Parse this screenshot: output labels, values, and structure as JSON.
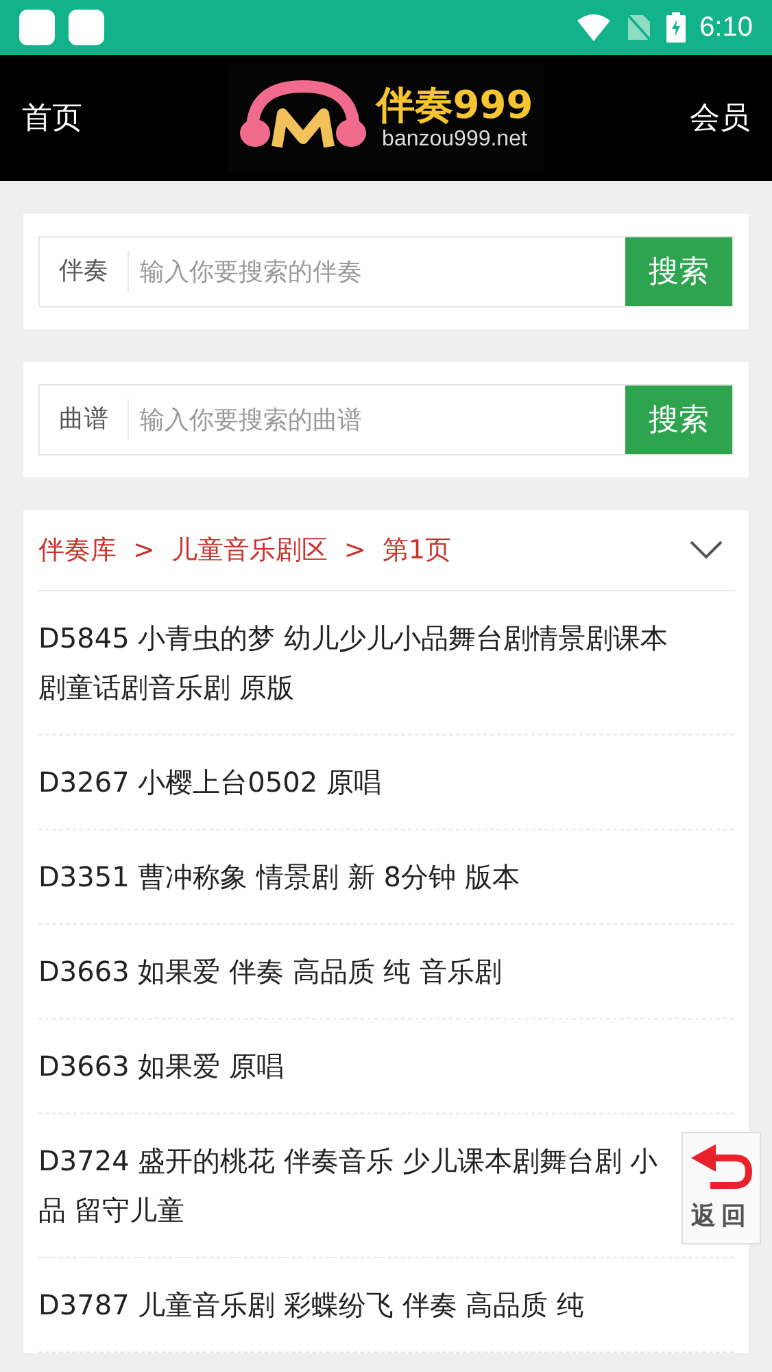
{
  "status_bar": {
    "time": "6:10"
  },
  "header": {
    "left_link": "首页",
    "logo": {
      "title": "伴奏999",
      "domain": "banzou999.net"
    },
    "right_link": "会员"
  },
  "searches": [
    {
      "label": "伴奏",
      "placeholder": "输入你要搜索的伴奏",
      "button": "搜索"
    },
    {
      "label": "曲谱",
      "placeholder": "输入你要搜索的曲谱",
      "button": "搜索"
    }
  ],
  "breadcrumb": {
    "items": [
      "伴奏库",
      "儿童音乐剧区",
      "第1页"
    ],
    "separator": ">",
    "expanded": false
  },
  "list": [
    {
      "title": "D5845 小青虫的梦 幼儿少儿小品舞台剧情景剧课本剧童话剧音乐剧 原版"
    },
    {
      "title": "D3267 小樱上台0502 原唱"
    },
    {
      "title": "D3351 曹冲称象 情景剧 新 8分钟 版本"
    },
    {
      "title": "D3663 如果爱 伴奏 高品质 纯 音乐剧"
    },
    {
      "title": "D3663 如果爱 原唱"
    },
    {
      "title": "D3724 盛开的桃花 伴奏音乐 少儿课本剧舞台剧 小品 留守儿童"
    },
    {
      "title": "D3787 儿童音乐剧 彩蝶纷飞 伴奏 高品质 纯"
    }
  ],
  "back_button": {
    "label": "返回"
  }
}
